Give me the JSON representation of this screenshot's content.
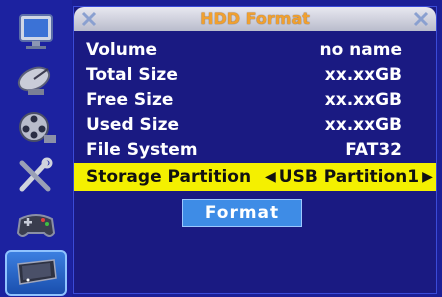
{
  "sidebar": {
    "items": [
      {
        "name": "sidebar-item-display",
        "icon": "monitor-icon"
      },
      {
        "name": "sidebar-item-satellite",
        "icon": "satellite-dish-icon"
      },
      {
        "name": "sidebar-item-media",
        "icon": "film-reel-icon"
      },
      {
        "name": "sidebar-item-tools",
        "icon": "tools-icon"
      },
      {
        "name": "sidebar-item-games",
        "icon": "gamepad-icon"
      },
      {
        "name": "sidebar-item-storage",
        "icon": "hard-disk-icon",
        "selected": true
      }
    ]
  },
  "panel": {
    "title": "HDD Format",
    "rows": [
      {
        "label": "Volume",
        "value": "no name"
      },
      {
        "label": "Total Size",
        "value": "xx.xxGB"
      },
      {
        "label": "Free Size",
        "value": "xx.xxGB"
      },
      {
        "label": "Used Size",
        "value": "xx.xxGB"
      },
      {
        "label": "File System",
        "value": "FAT32"
      }
    ],
    "partition": {
      "label": "Storage Partition",
      "value": "USB Partition1",
      "left_arrow": "◀",
      "right_arrow": "▶"
    },
    "format_button": "Format"
  },
  "colors": {
    "background": "#1b1f96",
    "highlight": "#f4f000",
    "button": "#3e8ce6",
    "title_text": "#f0a030"
  }
}
